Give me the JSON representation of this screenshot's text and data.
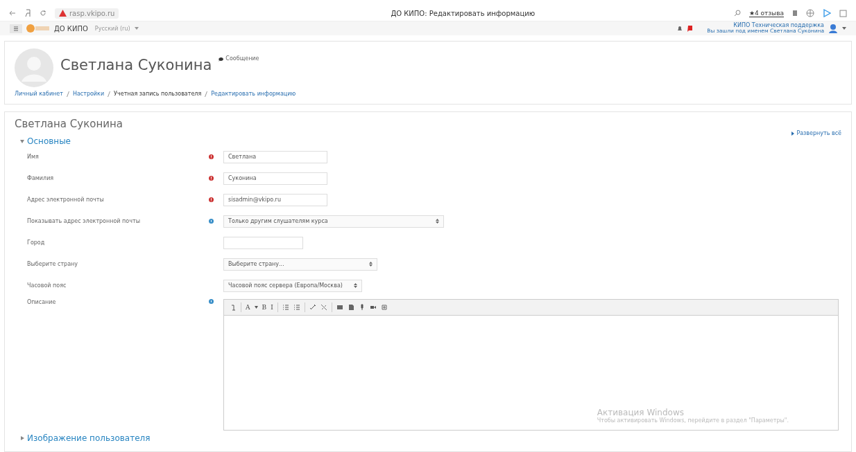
{
  "browser": {
    "url": "rasp.vkipo.ru",
    "tab_title": "ДО КИПО: Редактировать информацию",
    "reviews": "★4 отзыва"
  },
  "navbar": {
    "site": "ДО КИПО",
    "language": "Русский (ru)",
    "user_name": "КИПО Техническая поддержка",
    "user_note": "Вы зашли под именем Светлана Суконина"
  },
  "profile": {
    "name": "Светлана Суконина",
    "message": "Сообщение"
  },
  "breadcrumb": [
    {
      "label": "Личный кабинет",
      "link": true
    },
    {
      "label": "Настройки",
      "link": true
    },
    {
      "label": "Учетная запись пользователя",
      "link": false
    },
    {
      "label": "Редактировать информацию",
      "link": true
    }
  ],
  "form": {
    "title": "Светлана Суконина",
    "expand_all": "Развернуть всё",
    "sections": [
      {
        "title": "Основные",
        "expanded": true
      },
      {
        "title": "Изображение пользователя",
        "expanded": false
      }
    ],
    "fields": [
      {
        "label": "Имя",
        "required": true,
        "help": false,
        "kind": "text",
        "value": "Светлана"
      },
      {
        "label": "Фамилия",
        "required": true,
        "help": false,
        "kind": "text",
        "value": "Суконина"
      },
      {
        "label": "Адрес электронной почты",
        "required": true,
        "help": false,
        "kind": "text",
        "value": "sisadmin@vkipo.ru"
      },
      {
        "label": "Показывать адрес электронной почты",
        "required": false,
        "help": true,
        "kind": "select",
        "value": "Только другим слушателям курса"
      },
      {
        "label": "Город",
        "required": false,
        "help": false,
        "kind": "text"
      },
      {
        "label": "Выберите страну",
        "required": false,
        "help": false,
        "kind": "select",
        "value": "Выберите страну..."
      },
      {
        "label": "Часовой пояс",
        "required": false,
        "help": false,
        "kind": "select",
        "value": "Часовой пояс сервера (Европа/Москва)"
      },
      {
        "label": "Описание",
        "required": false,
        "help": true,
        "kind": "editor"
      }
    ],
    "toolbar": [
      [
        {
          "kind": "collapse"
        }
      ],
      [
        {
          "kind": "text",
          "label": "A"
        },
        {
          "kind": "text",
          "label": "B"
        },
        {
          "kind": "text",
          "label": "I"
        }
      ],
      [
        {
          "kind": "list"
        },
        {
          "kind": "list"
        }
      ],
      [
        {
          "kind": "link"
        },
        {
          "kind": "unlink"
        }
      ],
      [
        {
          "kind": "image"
        },
        {
          "kind": "media"
        },
        {
          "kind": "mic"
        },
        {
          "kind": "video"
        },
        {
          "kind": "files"
        }
      ]
    ]
  },
  "os_notice": {
    "title": "Активация Windows",
    "text": "Чтобы активировать Windows, перейдите в раздел \"Параметры\"."
  }
}
